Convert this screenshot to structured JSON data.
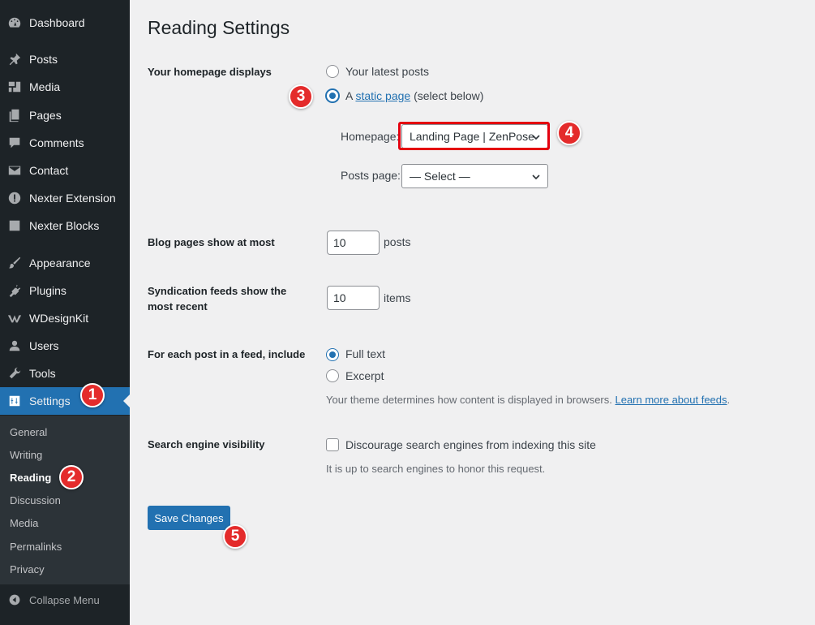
{
  "sidebar": {
    "items": [
      {
        "label": "Dashboard",
        "icon": "dashboard-icon"
      },
      {
        "label": "Posts",
        "icon": "pin-icon"
      },
      {
        "label": "Media",
        "icon": "media-icon"
      },
      {
        "label": "Pages",
        "icon": "pages-icon"
      },
      {
        "label": "Comments",
        "icon": "comment-icon"
      },
      {
        "label": "Contact",
        "icon": "envelope-icon"
      },
      {
        "label": "Nexter Extension",
        "icon": "exclamation-icon"
      },
      {
        "label": "Nexter Blocks",
        "icon": "square-icon"
      },
      {
        "label": "Appearance",
        "icon": "brush-icon"
      },
      {
        "label": "Plugins",
        "icon": "plug-icon"
      },
      {
        "label": "WDesignKit",
        "icon": "wdesignkit-icon"
      },
      {
        "label": "Users",
        "icon": "user-icon"
      },
      {
        "label": "Tools",
        "icon": "wrench-icon"
      },
      {
        "label": "Settings",
        "icon": "settings-icon"
      }
    ],
    "submenu": [
      "General",
      "Writing",
      "Reading",
      "Discussion",
      "Media",
      "Permalinks",
      "Privacy"
    ],
    "collapse_label": "Collapse Menu"
  },
  "page": {
    "title": "Reading Settings",
    "homepage_displays": {
      "label": "Your homepage displays",
      "option_latest": "Your latest posts",
      "option_static_prefix": "A ",
      "option_static_link": "static page",
      "option_static_suffix": " (select below)",
      "homepage_label": "Homepage:",
      "homepage_value": "Landing Page | ZenPose",
      "posts_page_label": "Posts page:",
      "posts_page_value": "— Select —"
    },
    "blog_pages": {
      "label": "Blog pages show at most",
      "value": "10",
      "suffix": "posts"
    },
    "syndication": {
      "label": "Syndication feeds show the most recent",
      "value": "10",
      "suffix": "items"
    },
    "feed_include": {
      "label": "For each post in a feed, include",
      "option_full": "Full text",
      "option_excerpt": "Excerpt",
      "description": "Your theme determines how content is displayed in browsers. ",
      "description_link": "Learn more about feeds",
      "description_end": "."
    },
    "search_visibility": {
      "label": "Search engine visibility",
      "checkbox_label": "Discourage search engines from indexing this site",
      "description": "It is up to search engines to honor this request."
    },
    "save_label": "Save Changes"
  },
  "badges": [
    "1",
    "2",
    "3",
    "4",
    "5"
  ],
  "colors": {
    "accent": "#2271b1",
    "sidebar": "#1d2327",
    "badge": "#e42b2b",
    "highlight": "#e4000f"
  }
}
